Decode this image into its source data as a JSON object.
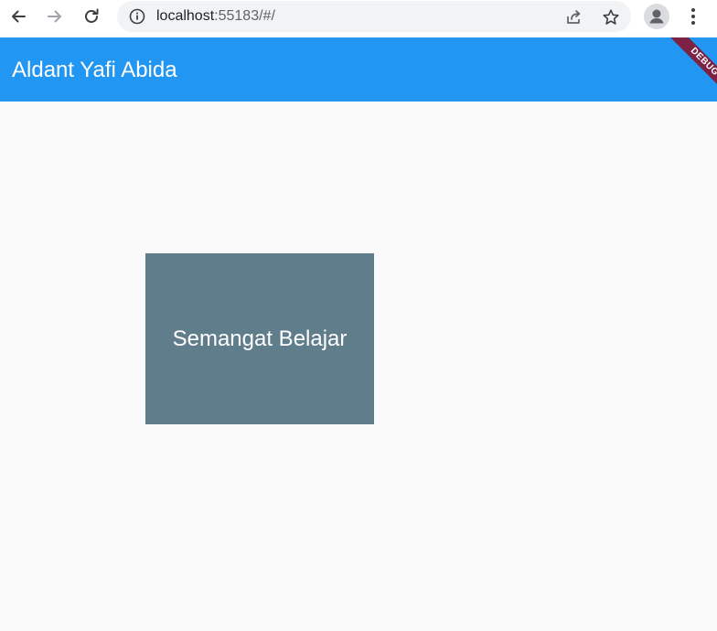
{
  "browser": {
    "url_host": "localhost",
    "url_path": ":55183/#/",
    "icons": {
      "back": "arrow-left-icon",
      "forward": "arrow-right-icon",
      "reload": "reload-icon",
      "site_info": "info-icon",
      "share": "share-icon",
      "bookmark": "star-icon",
      "profile": "person-icon",
      "menu": "kebab-menu-icon"
    }
  },
  "app_bar": {
    "title": "Aldant Yafi Abida",
    "color": "#2196f3"
  },
  "debug_banner": {
    "label": "DEBUG",
    "color": "#7c2244"
  },
  "main": {
    "card": {
      "text": "Semangat Belajar",
      "color": "#607d8b"
    }
  }
}
